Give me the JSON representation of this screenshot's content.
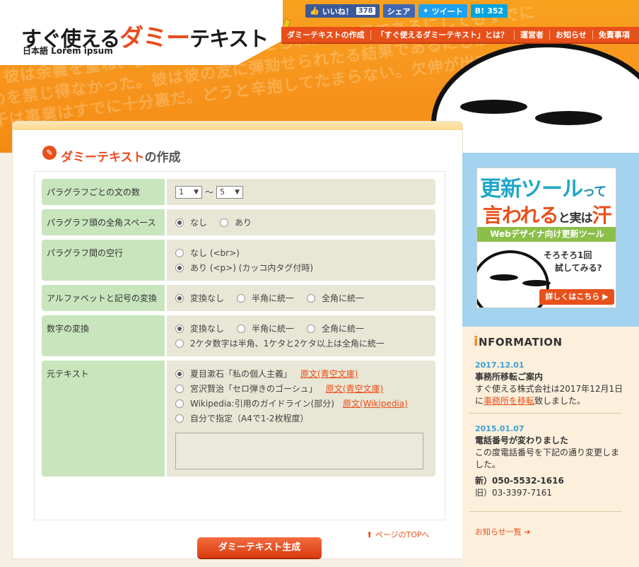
{
  "header": {
    "background_text": [
      "は、彼は余義を重ね、彼は彼の友に弾劾せられたる結果であるにしてもすでに",
      "ものを禁じ得なかった。彼は彼の友に弾劾せられたる結果であるにしかし",
      "五千は事業はすでに十分裏だ。どうと辛抱してたまらない。欠伸が出ている"
    ],
    "logo_main_prefix": "すぐ使える",
    "logo_main_accent": "ダミー",
    "logo_main_suffix": "テキスト",
    "logo_sub": "日本語 Lorem ipsum",
    "social": {
      "like_label": "いいね！",
      "like_count": "378",
      "share_label": "シェア",
      "tweet_label": "ツイート",
      "hatena_label": "B!",
      "hatena_count": "352"
    },
    "nav": [
      "ダミーテキストの作成",
      "「すぐ使えるダミーテキスト」とは？",
      "運営者",
      "お知らせ",
      "免責事項"
    ]
  },
  "main": {
    "title_accent": "ダミーテキスト",
    "title_suffix": "の作成",
    "rows": {
      "sentences": {
        "label": "パラグラフごとの文の数",
        "from": "1",
        "to": "5",
        "sep": "〜"
      },
      "indent": {
        "label": "パラグラフ頭の全角スペース",
        "options": [
          "なし",
          "あり"
        ]
      },
      "blankline": {
        "label": "パラグラフ間の空行",
        "options": [
          "なし (<br>)",
          "あり (<p>)   (カッコ内タグ付時)"
        ]
      },
      "alphabet": {
        "label": "アルファベットと記号の変換",
        "options": [
          "変換なし",
          "半角に統一",
          "全角に統一"
        ]
      },
      "number": {
        "label": "数字の変換",
        "options": [
          "変換なし",
          "半角に統一",
          "全角に統一"
        ],
        "option_extra": "2ケタ数字は半角、1ケタと2ケタ以上は全角に統一"
      },
      "source": {
        "label": "元テキスト",
        "options": [
          {
            "text": "夏目漱石「私の個人主義」",
            "link": "原文(青空文庫)"
          },
          {
            "text": "宮沢賢治「セロ弾きのゴーシュ」",
            "link": "原文(青空文庫)"
          },
          {
            "text": "Wikipedia:引用のガイドライン(部分)",
            "link": "原文(Wikipedia)"
          },
          {
            "text": "自分で指定（A4で1-2枚程度）",
            "link": ""
          }
        ]
      }
    },
    "generate_button": "ダミーテキスト生成",
    "page_top": "ページのTOPへ"
  },
  "sidebar": {
    "ad": {
      "line1_main": "更新ツール",
      "line1_small": "って",
      "line2_main1": "言われる",
      "line2_small": "と実は",
      "line2_main2": "汗",
      "band": "Webデザイナ向け更新ツール",
      "text1": "そろそろ1回",
      "text2": "試してみる?",
      "button": "詳しくはこちら"
    },
    "info": {
      "title_initial": "i",
      "title_rest": "NFORMATION",
      "news": [
        {
          "date": "2017.12.01",
          "title": "事務所移転ご案内",
          "body_before": "すぐ使える株式会社は2017年12月1日に",
          "body_link": "事務所を移転",
          "body_after": "致しました。"
        },
        {
          "date": "2015.01.07",
          "title": "電話番号が変わりました",
          "body": "この度電話番号を下記の通り変更しました。",
          "new_phone": "新）050-5532-1616",
          "old_phone": "旧）03-3397-7161"
        }
      ],
      "more": "お知らせ一覧"
    }
  },
  "colors": {
    "accent": "#e8501a",
    "header_orange": "#f7941d",
    "label_green": "#c8e5bd",
    "value_bg": "#e8e6d5",
    "info_date": "#3ca0d0"
  }
}
